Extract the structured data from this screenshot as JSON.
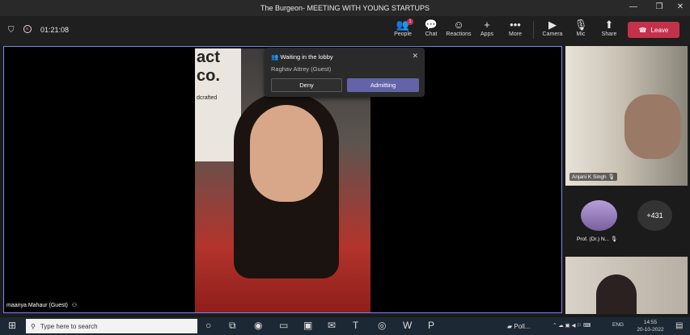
{
  "window": {
    "title": "The Burgeon- MEETING WITH YOUNG STARTUPS"
  },
  "meeting": {
    "timer": "01:21:08"
  },
  "toolbar": {
    "people": "People",
    "people_badge": "1",
    "chat": "Chat",
    "reactions": "Reactions",
    "apps": "Apps",
    "more": "More",
    "camera": "Camera",
    "mic": "Mic",
    "share": "Share",
    "leave": "Leave"
  },
  "lobby": {
    "title": "Waiting in the lobby",
    "guest": "Raghav Attrey (Guest)",
    "deny": "Deny",
    "admit": "Admitting"
  },
  "main_video": {
    "name": "maanya Mahaur (Guest)",
    "poster_text": "act\nco.",
    "poster_sub": "dcrafted"
  },
  "participants": {
    "p1": "Anjani K Singh",
    "p2": "Prof. (Dr.) N...",
    "overflow": "+431"
  },
  "taskbar": {
    "search_placeholder": "Type here to search",
    "app_label": "Poll...",
    "lang": "ENG",
    "time": "14:55",
    "date": "20-10-2022"
  },
  "colors": {
    "accent": "#6264a7",
    "leave": "#c4314b",
    "stage_border": "#7f85f5"
  }
}
